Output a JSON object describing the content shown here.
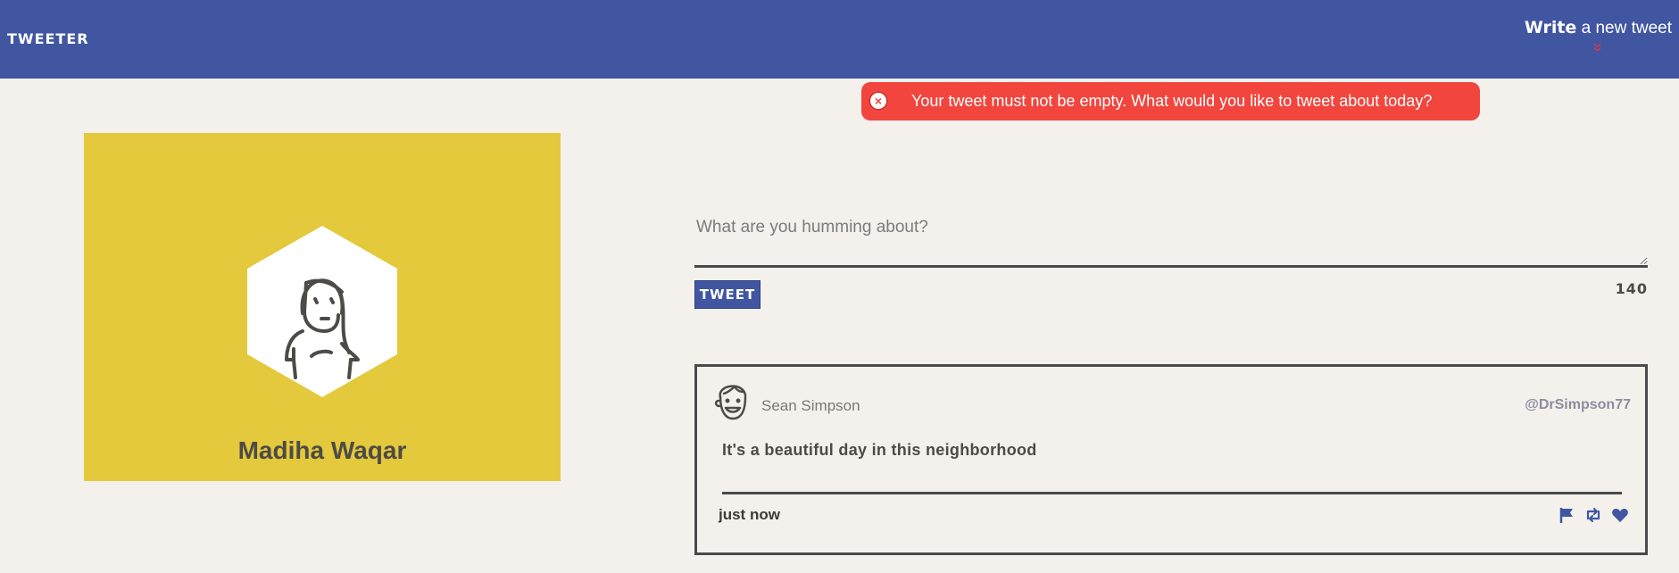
{
  "navbar": {
    "brand": "TWEETER",
    "compose_strong": "Write",
    "compose_rest": " a new tweet",
    "compose_arrow": "»"
  },
  "error": {
    "close_symbol": "×",
    "message": "Your tweet must not be empty. What would you like to tweet about today?"
  },
  "profile": {
    "name": "Madiha Waqar"
  },
  "composer": {
    "placeholder": "What are you humming about?",
    "submit_label": "TWEET",
    "counter": "140"
  },
  "tweet": {
    "author_name": "Sean Simpson",
    "handle": "@DrSimpson77",
    "content": "It's a beautiful day in this neighborhood",
    "time": "just now",
    "actions": [
      "flag-icon",
      "retweet-icon",
      "heart-icon"
    ]
  },
  "colors": {
    "nav": "#4056a1",
    "background": "#f4f1ec",
    "profile_bg": "#e3c93b",
    "error": "#f1453d",
    "accent_red": "#e8363b",
    "text_dark": "#4d4b47"
  }
}
